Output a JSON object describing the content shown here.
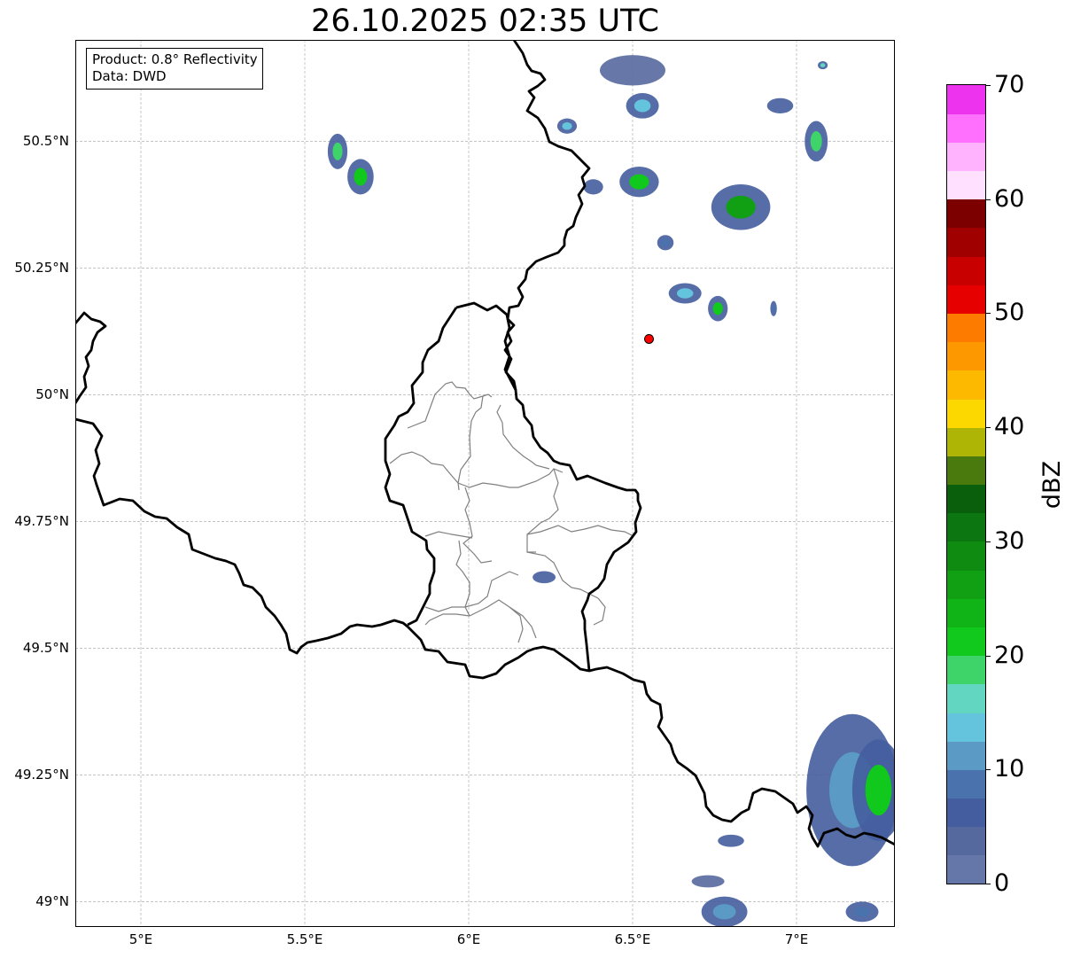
{
  "title": "26.10.2025 02:35 UTC",
  "info_box": {
    "product": "Product: 0.8° Reflectivity",
    "data": "Data: DWD"
  },
  "map": {
    "lon_range": [
      4.8,
      7.3
    ],
    "lat_range": [
      48.95,
      50.7
    ],
    "grid": true,
    "lat_ticks": [
      {
        "value": 50.5,
        "label": "50.5°N"
      },
      {
        "value": 50.25,
        "label": "50.25°N"
      },
      {
        "value": 50.0,
        "label": "50°N"
      },
      {
        "value": 49.75,
        "label": "49.75°N"
      },
      {
        "value": 49.5,
        "label": "49.5°N"
      },
      {
        "value": 49.25,
        "label": "49.25°N"
      },
      {
        "value": 49.0,
        "label": "49°N"
      }
    ],
    "lon_ticks": [
      {
        "value": 5.0,
        "label": "5°E"
      },
      {
        "value": 5.5,
        "label": "5.5°E"
      },
      {
        "value": 6.0,
        "label": "6°E"
      },
      {
        "value": 6.5,
        "label": "6.5°E"
      },
      {
        "value": 7.0,
        "label": "7°E"
      }
    ],
    "radar_site": {
      "lon": 6.55,
      "lat": 50.11,
      "color": "#ff0000"
    },
    "border_color": "#000000",
    "admin_color": "#808080",
    "echoes": [
      {
        "lon": 6.5,
        "lat": 50.64,
        "rx": 0.1,
        "ry": 0.03,
        "dbz": 4
      },
      {
        "lon": 6.53,
        "lat": 50.57,
        "rx": 0.05,
        "ry": 0.025,
        "dbz": 14
      },
      {
        "lon": 6.3,
        "lat": 50.53,
        "rx": 0.03,
        "ry": 0.015,
        "dbz": 14
      },
      {
        "lon": 6.52,
        "lat": 50.42,
        "rx": 0.06,
        "ry": 0.03,
        "dbz": 20
      },
      {
        "lon": 6.38,
        "lat": 50.41,
        "rx": 0.03,
        "ry": 0.015,
        "dbz": 5
      },
      {
        "lon": 6.83,
        "lat": 50.37,
        "rx": 0.09,
        "ry": 0.045,
        "dbz": 26
      },
      {
        "lon": 6.95,
        "lat": 50.57,
        "rx": 0.04,
        "ry": 0.015,
        "dbz": 5
      },
      {
        "lon": 7.06,
        "lat": 50.5,
        "rx": 0.035,
        "ry": 0.04,
        "dbz": 18
      },
      {
        "lon": 7.08,
        "lat": 50.65,
        "rx": 0.015,
        "ry": 0.008,
        "dbz": 17
      },
      {
        "lon": 5.6,
        "lat": 50.48,
        "rx": 0.03,
        "ry": 0.035,
        "dbz": 18
      },
      {
        "lon": 5.67,
        "lat": 50.43,
        "rx": 0.04,
        "ry": 0.035,
        "dbz": 22
      },
      {
        "lon": 6.6,
        "lat": 50.3,
        "rx": 0.025,
        "ry": 0.015,
        "dbz": 9
      },
      {
        "lon": 6.66,
        "lat": 50.2,
        "rx": 0.05,
        "ry": 0.02,
        "dbz": 14
      },
      {
        "lon": 6.76,
        "lat": 50.17,
        "rx": 0.03,
        "ry": 0.025,
        "dbz": 20
      },
      {
        "lon": 6.93,
        "lat": 50.17,
        "rx": 0.01,
        "ry": 0.015,
        "dbz": 9
      },
      {
        "lon": 6.23,
        "lat": 49.64,
        "rx": 0.035,
        "ry": 0.012,
        "dbz": 6
      },
      {
        "lon": 7.17,
        "lat": 49.22,
        "rx": 0.14,
        "ry": 0.15,
        "dbz": 10
      },
      {
        "lon": 7.25,
        "lat": 49.22,
        "rx": 0.08,
        "ry": 0.1,
        "dbz": 20
      },
      {
        "lon": 6.8,
        "lat": 49.12,
        "rx": 0.04,
        "ry": 0.012,
        "dbz": 7
      },
      {
        "lon": 6.73,
        "lat": 49.04,
        "rx": 0.05,
        "ry": 0.012,
        "dbz": 4
      },
      {
        "lon": 6.78,
        "lat": 48.98,
        "rx": 0.07,
        "ry": 0.03,
        "dbz": 12
      },
      {
        "lon": 7.2,
        "lat": 48.98,
        "rx": 0.05,
        "ry": 0.02,
        "dbz": 9
      }
    ]
  },
  "colorbar": {
    "label": "dBZ",
    "min": 0,
    "max": 70,
    "ticks": [
      {
        "value": 0,
        "label": "0"
      },
      {
        "value": 10,
        "label": "10"
      },
      {
        "value": 20,
        "label": "20"
      },
      {
        "value": 30,
        "label": "30"
      },
      {
        "value": 40,
        "label": "40"
      },
      {
        "value": 50,
        "label": "50"
      },
      {
        "value": 60,
        "label": "60"
      },
      {
        "value": 70,
        "label": "70"
      }
    ],
    "colors": [
      "#6577a9",
      "#56699e",
      "#445d9e",
      "#4a72ad",
      "#5a9ac4",
      "#65c4dd",
      "#62d6c0",
      "#3ed46a",
      "#11c81c",
      "#11b416",
      "#119f14",
      "#0f8b12",
      "#0c7610",
      "#095f0b",
      "#4a7a0d",
      "#aeb505",
      "#fdd800",
      "#fdb800",
      "#fd9800",
      "#fd7c00",
      "#e60000",
      "#c80000",
      "#a00000",
      "#7d0000",
      "#ffe0ff",
      "#ffb3ff",
      "#ff70ff",
      "#ee33ee"
    ]
  }
}
